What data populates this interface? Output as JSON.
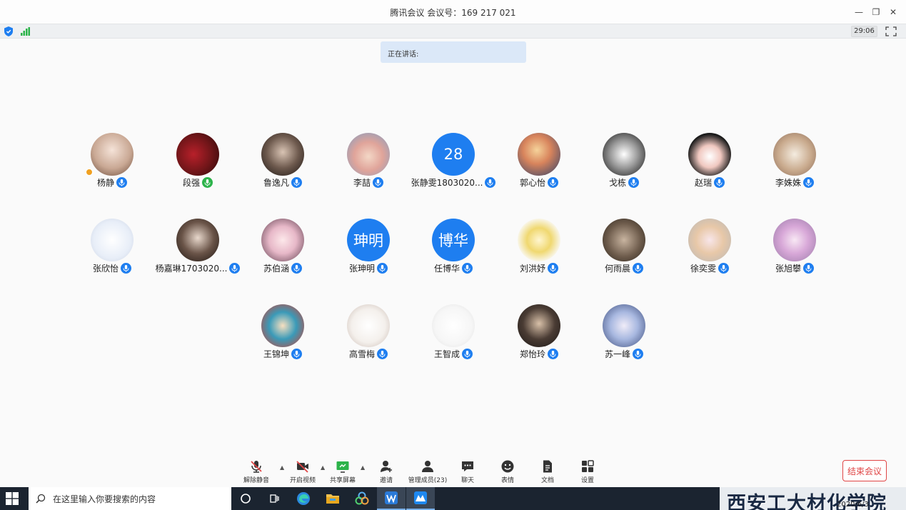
{
  "window": {
    "title": "腾讯会议 会议号：169 217 021",
    "minimize": "—",
    "restore": "❐",
    "close": "✕"
  },
  "status": {
    "timer": "29:06"
  },
  "speaking": {
    "label": "正在讲话:"
  },
  "colors": {
    "accent": "#1e7ef0",
    "end": "#e04545",
    "mic_on": "#1e7ef0",
    "mic_green": "#2cb34a"
  },
  "participants": [
    {
      "name": "杨静",
      "avatar": "img1",
      "host": true
    },
    {
      "name": "段强",
      "avatar": "img2",
      "mic": "green"
    },
    {
      "name": "鲁逸凡",
      "avatar": "img3"
    },
    {
      "name": "李喆",
      "avatar": "img4"
    },
    {
      "name": "张静雯1803020...",
      "avatar_text": "28"
    },
    {
      "name": "郭心怡",
      "avatar": "img5"
    },
    {
      "name": "戈栋",
      "avatar": "img6"
    },
    {
      "name": "赵瑞",
      "avatar": "img7"
    },
    {
      "name": "李姝姝",
      "avatar": "img8"
    },
    {
      "name": "张欣怡",
      "avatar": "img9"
    },
    {
      "name": "杨嘉琳1703020...",
      "avatar": "img10"
    },
    {
      "name": "苏伯涵",
      "avatar": "img11"
    },
    {
      "name": "张珅明",
      "avatar_text": "珅明"
    },
    {
      "name": "任博华",
      "avatar_text": "博华"
    },
    {
      "name": "刘洪妤",
      "avatar": "img12"
    },
    {
      "name": "何雨晨",
      "avatar": "img13"
    },
    {
      "name": "徐奕雯",
      "avatar": "img14"
    },
    {
      "name": "张旭攀",
      "avatar": "img15"
    },
    {
      "name": "王锦坤",
      "avatar": "img16"
    },
    {
      "name": "高雪梅",
      "avatar": "img17"
    },
    {
      "name": "王智成",
      "avatar": "img18"
    },
    {
      "name": "郑怡玲",
      "avatar": "img19"
    },
    {
      "name": "苏一峰",
      "avatar": "img20"
    }
  ],
  "toolbar": {
    "unmute": "解除静音",
    "video": "开启视频",
    "share": "共享屏幕",
    "invite": "邀请",
    "members": "管理成员(23)",
    "chat": "聊天",
    "emoji": "表情",
    "docs": "文档",
    "settings": "设置",
    "end": "结束会议",
    "caret": "▲"
  },
  "taskbar": {
    "search_placeholder": "在这里输入你要搜索的内容",
    "date": "2020/6/3",
    "watermark": "西安工大材化学院"
  }
}
